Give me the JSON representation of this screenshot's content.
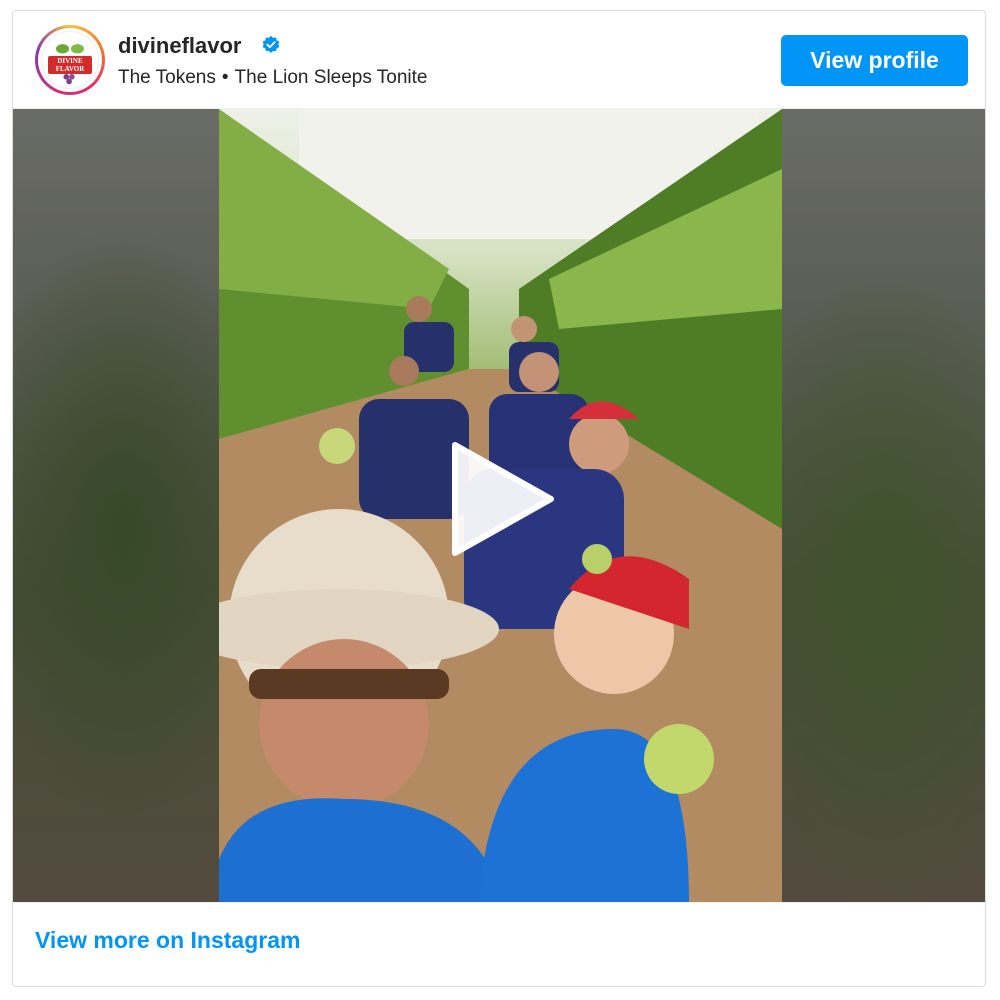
{
  "header": {
    "username": "divineflavor",
    "verified": true,
    "audio_artist": "The Tokens",
    "separator": "•",
    "audio_title": "The Lion Sleeps Tonite",
    "view_profile_label": "View profile",
    "avatar_logo_text": "DIVINE FLAVOR"
  },
  "media": {
    "type": "video",
    "play_icon": "play-icon"
  },
  "footer": {
    "view_more_label": "View more on Instagram"
  },
  "colors": {
    "accent": "#0095f6",
    "border": "#dbdbdb",
    "verified_badge": "#0095f6"
  }
}
